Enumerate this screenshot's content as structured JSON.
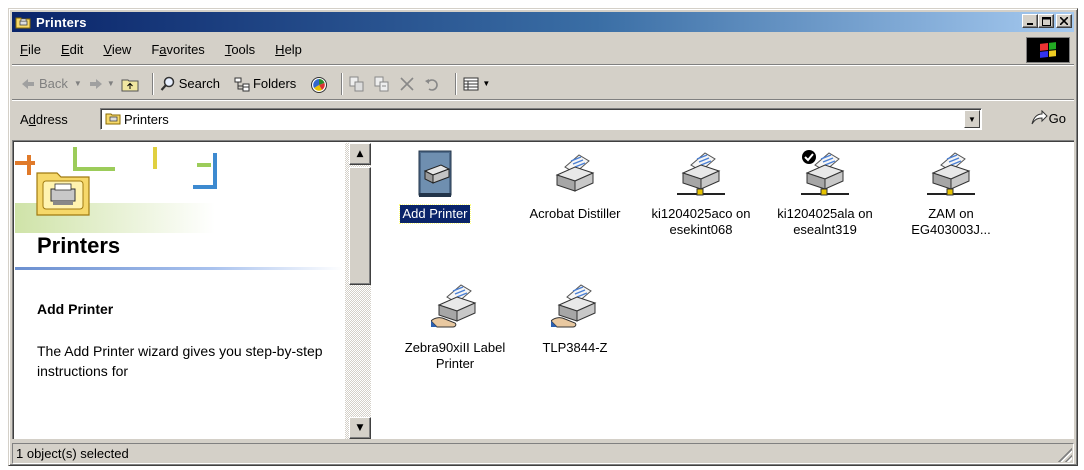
{
  "window": {
    "title": "Printers",
    "buttons": {
      "minimize": "_",
      "maximize": "□",
      "close": "×"
    }
  },
  "menu": [
    "File",
    "Edit",
    "View",
    "Favorites",
    "Tools",
    "Help"
  ],
  "menu_mnemonics": [
    "F",
    "E",
    "V",
    "a",
    "T",
    "H"
  ],
  "toolbar": {
    "back": "Back",
    "search": "Search",
    "folders": "Folders"
  },
  "address": {
    "label": "Address",
    "value": "Printers",
    "go": "Go"
  },
  "leftpane": {
    "title": "Printers",
    "subtitle": "Add Printer",
    "description": "The Add Printer wizard gives you step-by-step instructions for"
  },
  "items": [
    {
      "label": "Add Printer",
      "selected": true,
      "kind": "add-printer-icon"
    },
    {
      "label": "Acrobat Distiller",
      "kind": "printer-icon"
    },
    {
      "label": "ki1204025aco on esekint068",
      "kind": "network-printer-icon"
    },
    {
      "label": "ki1204025ala on esealnt319",
      "kind": "network-printer-default-icon"
    },
    {
      "label": "ZAM on EG403003J...",
      "kind": "network-printer-icon"
    },
    {
      "label": "Zebra90xiII Label Printer",
      "kind": "shared-printer-icon"
    },
    {
      "label": "TLP3844-Z",
      "kind": "shared-printer-icon"
    }
  ],
  "status": {
    "text": "1 object(s) selected"
  },
  "colors": {
    "titlebar": "#0a246a",
    "face": "#d4d0c8",
    "selection": "#0a246a"
  }
}
